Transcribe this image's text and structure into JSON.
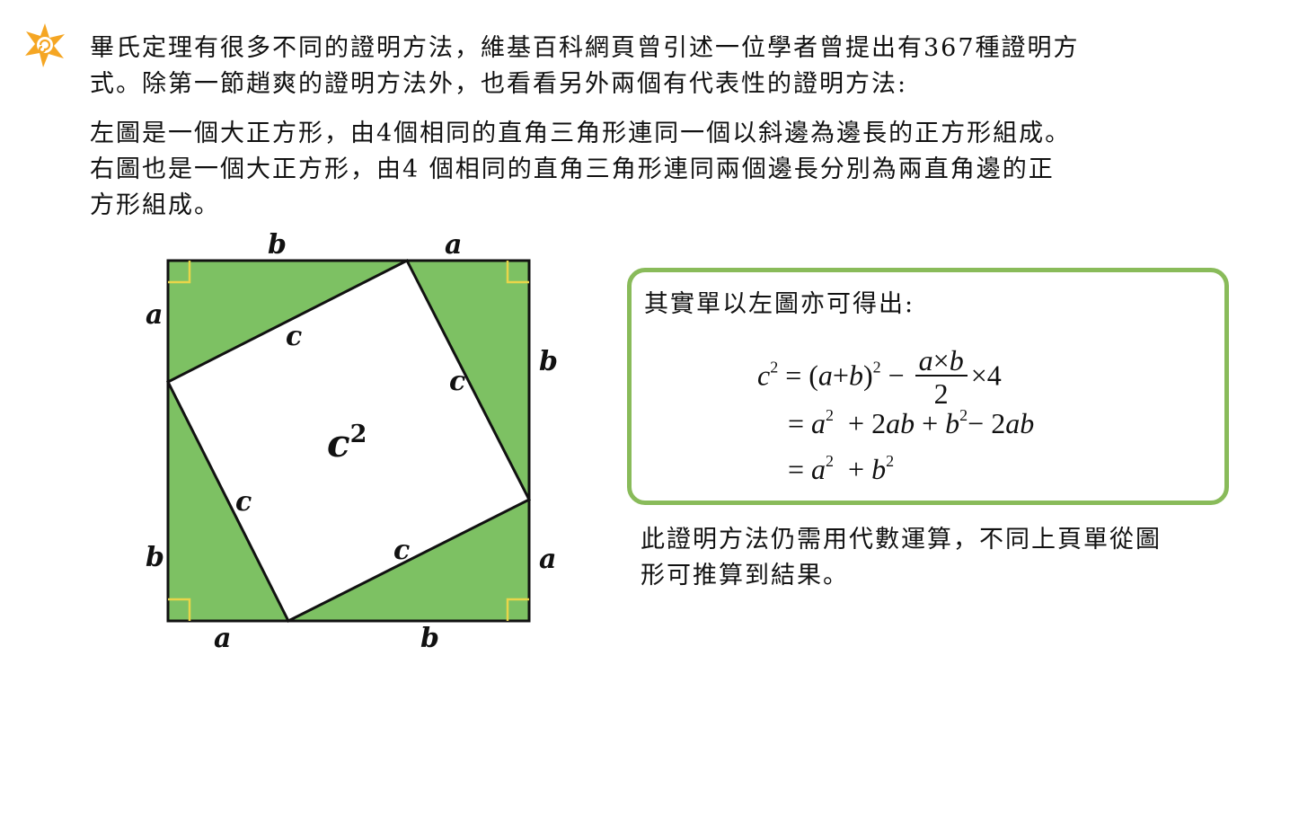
{
  "colors": {
    "accent_green": "#7dc163",
    "box_border": "#89bb5a",
    "right_angle_marker": "#e8d54a",
    "star": "#f5a623"
  },
  "icon": "star-logo-icon",
  "intro": {
    "line1": "畢氏定理有很多不同的證明方法，維基百科網頁曾引述一位學者曾提出有367種證明方",
    "line2": "式。除第一節趙爽的證明方法外，也看看另外兩個有代表性的證明方法:"
  },
  "description": {
    "line1": "左圖是一個大正方形，由4個相同的直角三角形連同一個以斜邊為邊長的正方形組成。",
    "line2": "右圖也是一個大正方形，由4 個相同的直角三角形連同兩個邊長分別為兩直角邊的正",
    "line3": "方形組成。"
  },
  "diagram": {
    "top_b": "b",
    "top_a": "a",
    "left_a": "a",
    "left_b": "b",
    "right_b": "b",
    "right_a": "a",
    "bottom_a": "a",
    "bottom_b": "b",
    "hyp_top": "c",
    "hyp_right": "c",
    "hyp_left": "c",
    "hyp_bottom": "c",
    "center": "c",
    "center_exp": "2"
  },
  "formula_box": {
    "intro": "其實單以左圖亦可得出:",
    "line1": {
      "c": "c",
      "c_exp": "2",
      "eq": "=",
      "open": "(",
      "a": "a",
      "plus": "+",
      "b": "b",
      "close": ")",
      "exp": "2",
      "minus": "−",
      "num_a": "a",
      "times": "×",
      "num_b": "b",
      "den": "2",
      "times4": "×",
      "four": "4"
    },
    "line2": {
      "eq": "=",
      "a": "a",
      "a_exp": "2",
      "plus1": "+",
      "two": "2",
      "ab": "ab",
      "plus2": "+",
      "b": "b",
      "b_exp": "2",
      "minus": "−",
      "two2": "2",
      "ab2": "ab"
    },
    "line3": {
      "eq": "=",
      "a": "a",
      "a_exp": "2",
      "plus": "+",
      "b": "b",
      "b_exp": "2"
    }
  },
  "conclusion": {
    "line1": "此證明方法仍需用代數運算，不同上頁單從圖",
    "line2": "形可推算到結果。"
  }
}
